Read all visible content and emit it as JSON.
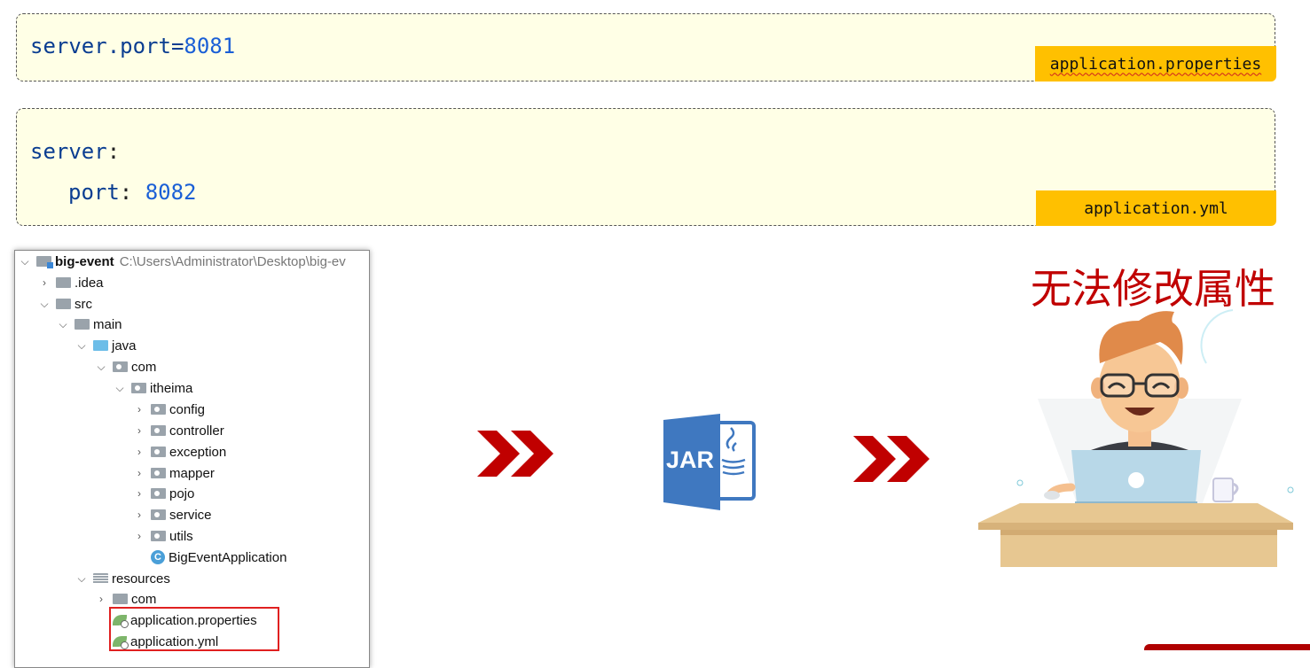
{
  "properties_box": {
    "code_key": "server.port=",
    "code_value": "8081",
    "file_tag": "application.properties"
  },
  "yml_box": {
    "line1_key": "server",
    "line1_colon": ":",
    "line2_key": "port",
    "line2_colon": ": ",
    "line2_value": "8082",
    "file_tag": "application.yml"
  },
  "project_tree": {
    "root_name": "big-event",
    "root_path": "C:\\Users\\Administrator\\Desktop\\big-ev",
    "items": [
      {
        "label": ".idea"
      },
      {
        "label": "src"
      },
      {
        "label": "main"
      },
      {
        "label": "java"
      },
      {
        "label": "com"
      },
      {
        "label": "itheima"
      },
      {
        "label": "config"
      },
      {
        "label": "controller"
      },
      {
        "label": "exception"
      },
      {
        "label": "mapper"
      },
      {
        "label": "pojo"
      },
      {
        "label": "service"
      },
      {
        "label": "utils"
      },
      {
        "label": "BigEventApplication"
      },
      {
        "label": "resources"
      },
      {
        "label": "com"
      },
      {
        "label": "application.properties"
      },
      {
        "label": "application.yml"
      }
    ]
  },
  "jar_icon": {
    "label": "JAR"
  },
  "caption": "无法修改属性",
  "colors": {
    "code_bg": "#ffffe6",
    "tag_bg": "#ffc000",
    "arrow": "#c00000",
    "caption": "#c00000",
    "highlight_border": "#e02020"
  }
}
